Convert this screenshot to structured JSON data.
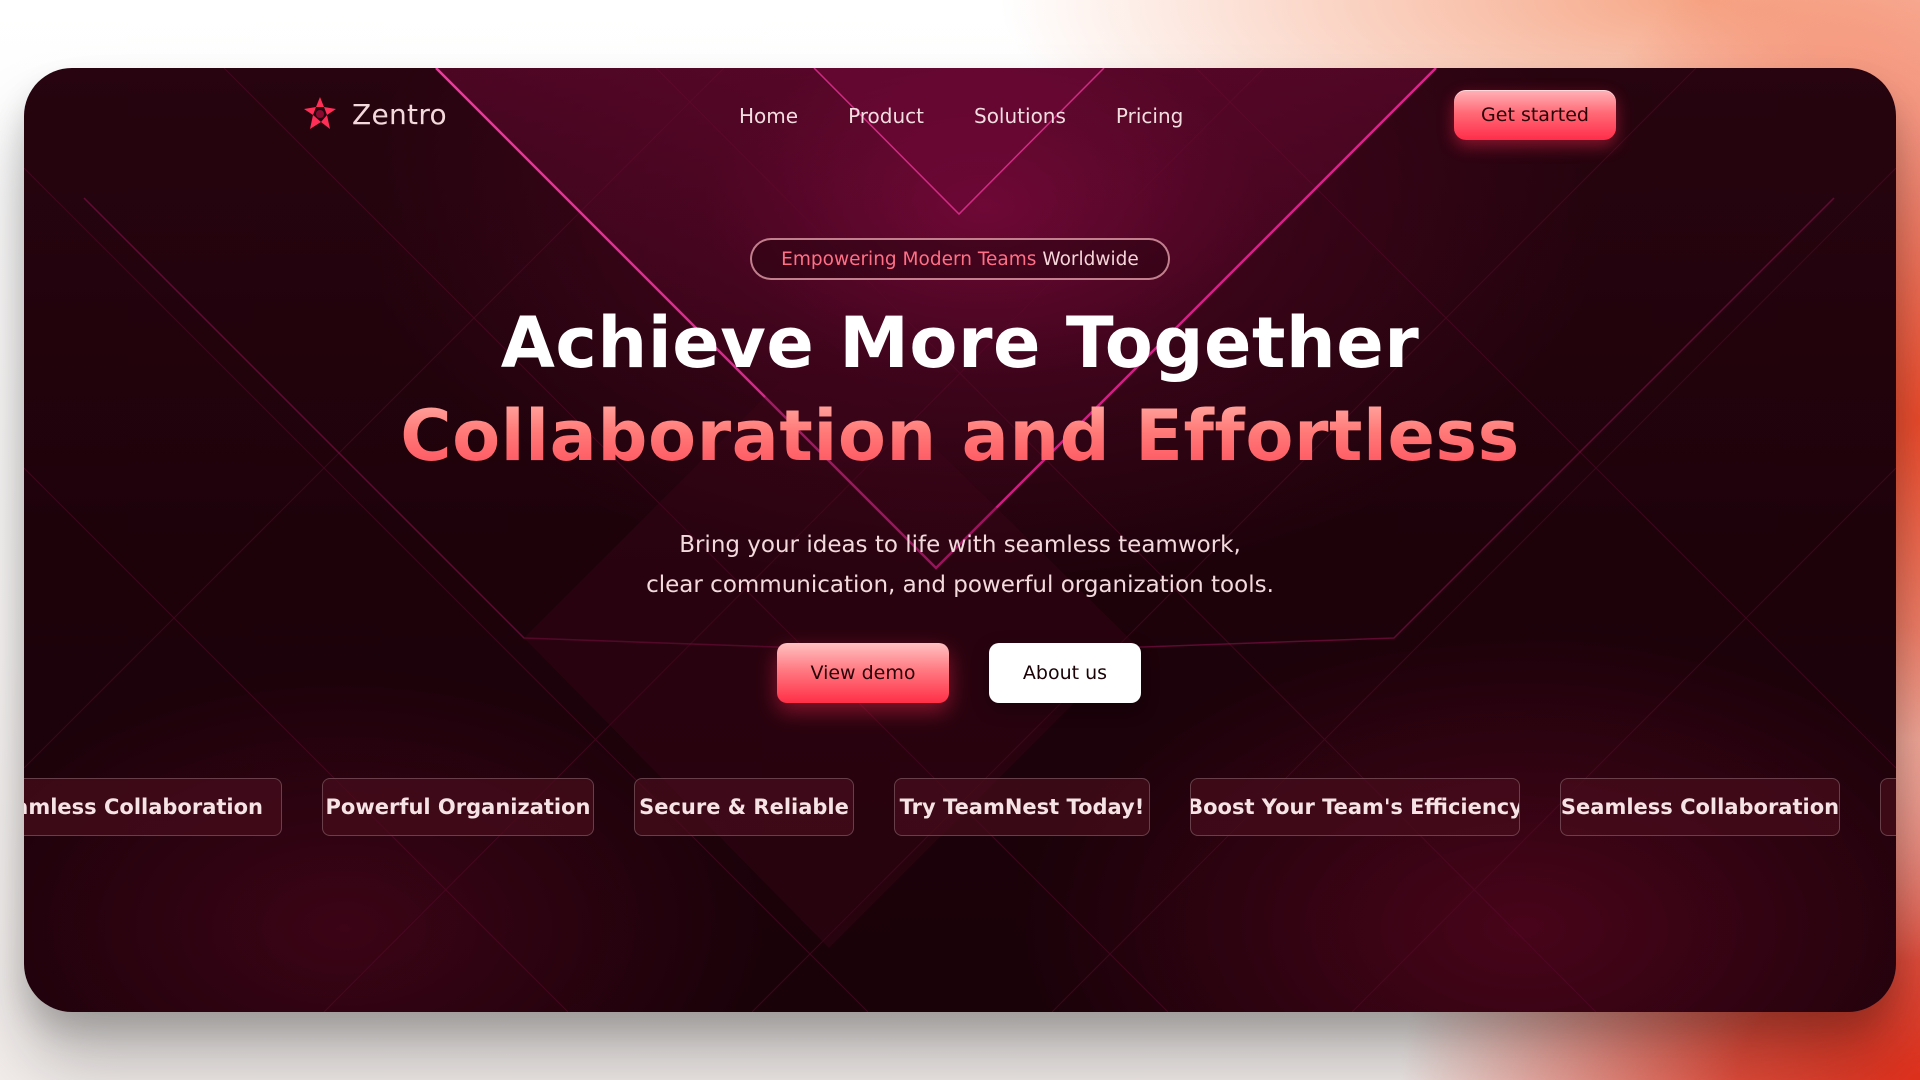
{
  "brand": {
    "name": "Zentro",
    "logo_icon": "star-logo-icon",
    "accent": "#ff3a55"
  },
  "nav": {
    "items": [
      {
        "label": "Home"
      },
      {
        "label": "Product"
      },
      {
        "label": "Solutions"
      },
      {
        "label": "Pricing"
      }
    ],
    "cta_label": "Get started"
  },
  "hero": {
    "badge_accent": "Empowering Modern Teams",
    "badge_rest": "Worldwide",
    "title_line1": "Achieve More Together",
    "title_line2": "Collaboration and Effortless",
    "subtitle_line1": "Bring your ideas to life with seamless teamwork,",
    "subtitle_line2": "clear communication, and powerful organization tools.",
    "primary_button": "View demo",
    "secondary_button": "About us"
  },
  "marquee": {
    "items": [
      "Seamless Collaboration",
      "Powerful Organization",
      "Secure & Reliable",
      "Try TeamNest Today!",
      "Boost Your Team's Efficiency",
      "Seamless Collaboration"
    ]
  },
  "colors": {
    "page_background": "#fbf8f7",
    "frame_background": "#1d020a",
    "title_gradient_start": "#ffb1a9",
    "title_gradient_end": "#ff4c5c",
    "badge_text": "#ff6f86",
    "chip_background": "#460c1c"
  }
}
